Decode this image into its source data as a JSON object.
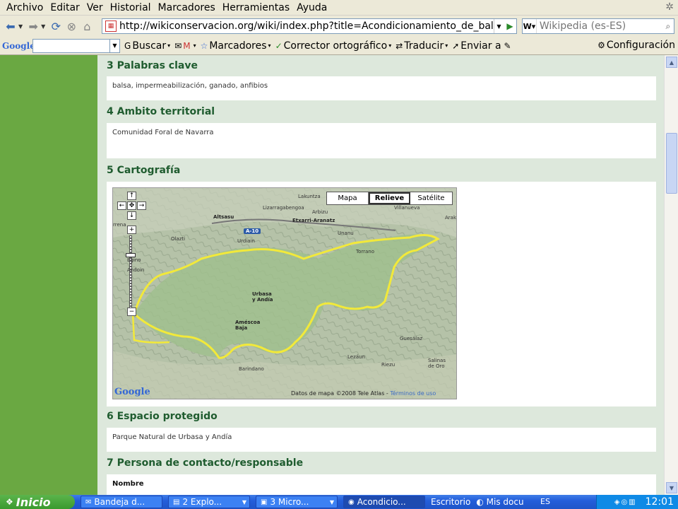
{
  "menu": [
    "Archivo",
    "Editar",
    "Ver",
    "Historial",
    "Marcadores",
    "Herramientas",
    "Ayuda"
  ],
  "nav": {
    "url": "http://wikiconservacion.org/wiki/index.php?title=Acondicionamiento_de_balsas",
    "search_placeholder": "Wikipedia (es-ES)"
  },
  "google_toolbar": {
    "logo": "Google",
    "buscar": "Buscar",
    "marcadores": "Marcadores",
    "corrector": "Corrector ortográfico",
    "traducir": "Traducir",
    "enviar": "Enviar a",
    "configuracion": "Configuración"
  },
  "sections": [
    {
      "heading": "3 Palabras clave",
      "value": "balsa, impermeabilización, ganado, anfibios"
    },
    {
      "heading": "4 Ambito territorial",
      "value": "Comunidad Foral de Navarra"
    },
    {
      "heading": "5 Cartografía"
    },
    {
      "heading": "6 Espacio protegido",
      "value": "Parque Natural de Urbasa y Andía"
    },
    {
      "heading": "7 Persona de contacto/responsable",
      "value": "Nombre"
    }
  ],
  "map": {
    "types": [
      "Mapa",
      "Relieve",
      "Satélite"
    ],
    "active_type": "Relieve",
    "labels": {
      "lakuntza": "Lakuntza",
      "arbizu": "Arbizu",
      "lizarragabengoa": "Lizarragabengoa",
      "etxarri": "Etxarri-Aranatz",
      "altsasu": "Altsasu",
      "urdiain": "Urdiain",
      "olazti": "Olazti",
      "urbasa": "Urbasa\ny Andía",
      "amescoa": "Améscoa\nBaja",
      "lezaun": "Lezáun",
      "riezu": "Riezu",
      "guesalaz": "Guesálaz",
      "salinas": "Salinas\nde Oro",
      "torrano": "Torrano",
      "unanu": "Unanu",
      "arakil": "Araki",
      "andoin": "Andoin",
      "egino": "Egino",
      "arrena": "rrena",
      "villanueva": "Villanueva",
      "barindano": "Barindano"
    },
    "road_shield": "A-10",
    "logo": "Google",
    "credit": "Datos de mapa ©2008 Tele Atlas -",
    "terms": "Términos de uso"
  },
  "taskbar": {
    "start": "Inicio",
    "buttons": [
      "Bandeja d...",
      "2 Explo...",
      "3 Micro...",
      "Acondicio..."
    ],
    "quick": [
      "Escritorio",
      "Mis docu"
    ],
    "lang": "ES",
    "clock": "12:01"
  },
  "colors": {
    "heading_green": "#1f5c2f",
    "left_panel_green": "#6aa842",
    "page_bg": "#dde8dc",
    "boundary_yellow": "#f2e93a"
  }
}
